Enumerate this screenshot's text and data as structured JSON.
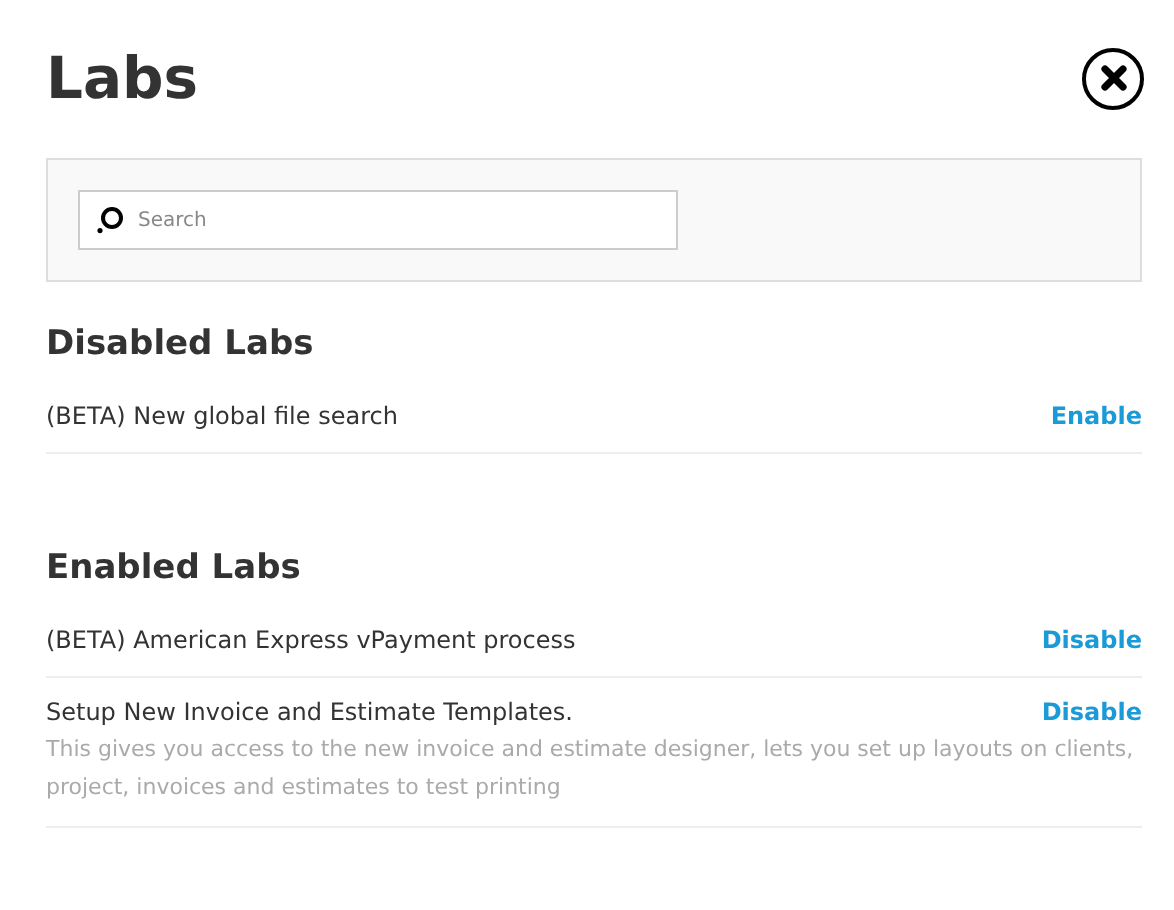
{
  "title": "Labs",
  "search": {
    "placeholder": "Search"
  },
  "sections": [
    {
      "heading": "Disabled Labs",
      "items": [
        {
          "label": "(BETA) New global file search",
          "action": "Enable"
        }
      ]
    },
    {
      "heading": "Enabled Labs",
      "items": [
        {
          "label": "(BETA) American Express vPayment process",
          "action": "Disable"
        },
        {
          "label": "Setup New Invoice and Estimate Templates.",
          "action": "Disable",
          "description": "This gives you access to the new invoice and estimate designer, lets you set up layouts on clients, project, invoices and estimates to test printing"
        }
      ]
    }
  ]
}
